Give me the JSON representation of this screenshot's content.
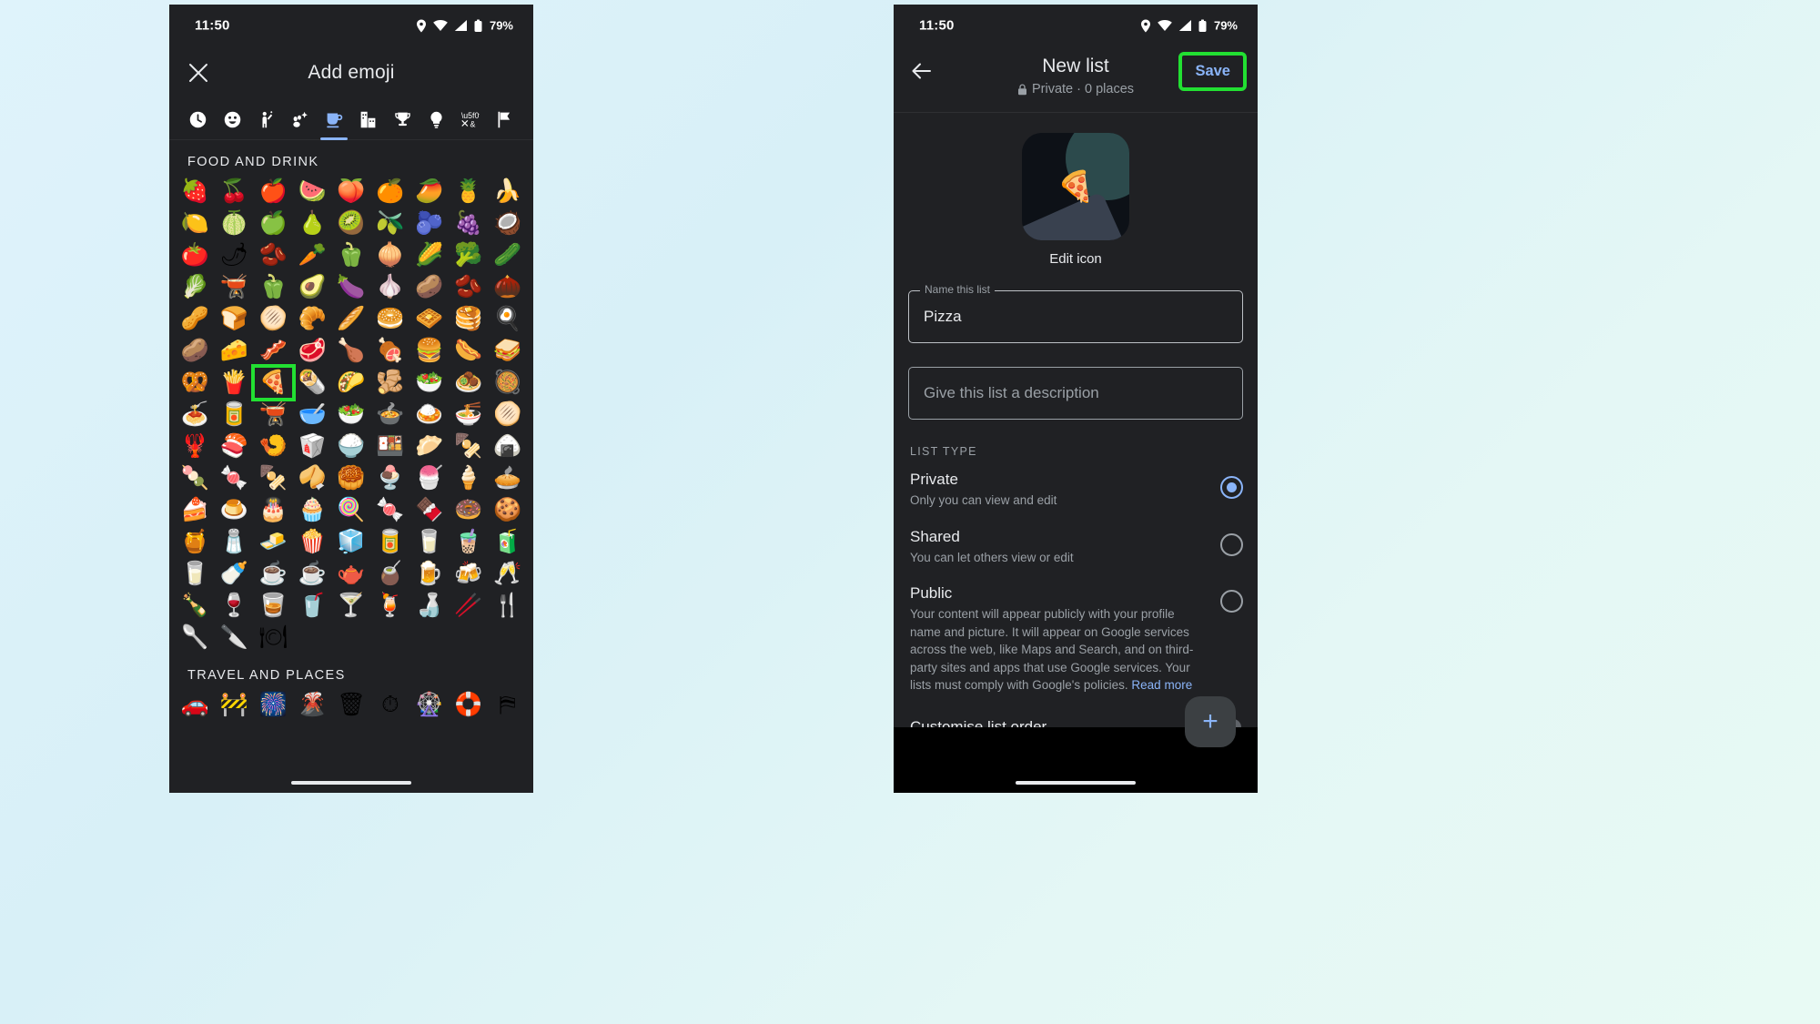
{
  "status": {
    "time": "11:50",
    "battery": "79%",
    "icons": [
      "location-icon",
      "wifi-icon",
      "signal-icon",
      "battery-icon"
    ]
  },
  "left_phone": {
    "header": {
      "close_label": "close-icon",
      "title": "Add emoji"
    },
    "category_tabs": [
      {
        "name": "recent",
        "glyph": "🕓",
        "active": false
      },
      {
        "name": "smileys-and-people",
        "glyph": "🙂",
        "active": false
      },
      {
        "name": "people-and-body",
        "glyph": "🙋",
        "active": false
      },
      {
        "name": "animals-and-nature",
        "glyph": "🐾",
        "active": false
      },
      {
        "name": "food-and-drink",
        "glyph": "☕",
        "active": true
      },
      {
        "name": "travel-and-places",
        "glyph": "🏙",
        "active": false
      },
      {
        "name": "activities",
        "glyph": "🏆",
        "active": false
      },
      {
        "name": "objects",
        "glyph": "💡",
        "active": false
      },
      {
        "name": "symbols",
        "glyph": "🔣",
        "active": false
      },
      {
        "name": "flags",
        "glyph": "🏳",
        "active": false
      }
    ],
    "sections": [
      {
        "title": "FOOD AND DRINK",
        "emojis": [
          "🍓",
          "🍒",
          "🍎",
          "🍉",
          "🍑",
          "🍊",
          "🥭",
          "🍍",
          "🍌",
          "🍋",
          "🍈",
          "🍏",
          "🍐",
          "🥝",
          "🫒",
          "🫐",
          "🍇",
          "🥥",
          "🍅",
          "🌶",
          "🫘",
          "🥕",
          "🫑",
          "🧅",
          "🌽",
          "🥦",
          "🥒",
          "🥬",
          "🫕",
          "🫑",
          "🥑",
          "🍆",
          "🧄",
          "🥔",
          "🫘",
          "🌰",
          "🥜",
          "🍞",
          "🫓",
          "🥐",
          "🥖",
          "🥯",
          "🧇",
          "🥞",
          "🍳",
          "🥔",
          "🧀",
          "🥓",
          "🥩",
          "🍗",
          "🍖",
          "🍔",
          "🌭",
          "🥪",
          "🥨",
          "🍟",
          "🍕",
          "🌯",
          "🌮",
          "🫚",
          "🥗",
          "🧆",
          "🥘",
          "🍝",
          "🥫",
          "🫕",
          "🥣",
          "🥗",
          "🍲",
          "🍛",
          "🍜",
          "🫓",
          "🦞",
          "🍣",
          "🍤",
          "🥡",
          "🍚",
          "🍱",
          "🥟",
          "🍢",
          "🍙",
          "🍡",
          "🍬",
          "🍢",
          "🥠",
          "🥮",
          "🍨",
          "🍧",
          "🍦",
          "🥧",
          "🍰",
          "🍮",
          "🎂",
          "🧁",
          "🍭",
          "🍬",
          "🍫",
          "🍩",
          "🍪",
          "🍯",
          "🧂",
          "🧈",
          "🍿",
          "🧊",
          "🥫",
          "🥛",
          "🧋",
          "🧃",
          "🥛",
          "🍼",
          "☕",
          "☕",
          "🫖",
          "🧉",
          "🍺",
          "🍻",
          "🥂",
          "🍾",
          "🍷",
          "🥃",
          "🥤",
          "🍸",
          "🍹",
          "🍶",
          "🥢",
          "🍴",
          "🥄",
          "🔪",
          "🍽"
        ],
        "highlight_index": 56,
        "highlight_color": "#22e032"
      },
      {
        "title": "TRAVEL AND PLACES",
        "emojis": [
          "🚗",
          "🚧",
          "🎆",
          "🌋",
          "🗑",
          "⏱",
          "🎡",
          "🛟",
          "⛿"
        ]
      }
    ]
  },
  "right_phone": {
    "header": {
      "back_label": "back-arrow-icon",
      "title": "New list",
      "subtitle": "Private · 0 places",
      "lock_icon": "lock-icon",
      "save_label": "Save",
      "save_color": "#8ab4f8",
      "highlight_color": "#22e032"
    },
    "icon_area": {
      "emoji": "🍕",
      "edit_label": "Edit icon"
    },
    "name_field": {
      "legend": "Name this list",
      "value": "Pizza"
    },
    "description_field": {
      "placeholder": "Give this list a description",
      "value": ""
    },
    "list_type": {
      "label": "LIST TYPE",
      "options": [
        {
          "title": "Private",
          "desc": "Only you can view and edit",
          "selected": true,
          "link": ""
        },
        {
          "title": "Shared",
          "desc": "You can let others view or edit",
          "selected": false,
          "link": ""
        },
        {
          "title": "Public",
          "desc": "Your content will appear publicly with your profile name and picture. It will appear on Google services across the web, like Maps and Search, and on third-party sites and apps that use Google services. Your lists must comply with Google's policies. ",
          "selected": false,
          "link": "Read more"
        }
      ]
    },
    "customise": {
      "label": "Customise list order",
      "enabled": false
    },
    "fab": {
      "label": "+",
      "name": "add-place-button"
    }
  }
}
